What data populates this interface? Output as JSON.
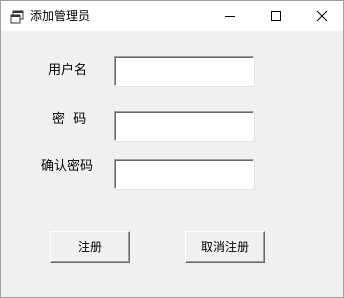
{
  "window": {
    "title": "添加管理员",
    "icon": "app-window-icon",
    "controls": [
      "minimize-icon",
      "maximize-icon",
      "close-icon"
    ]
  },
  "form": {
    "username_label": "用户名",
    "username_value": "",
    "password_label": "密  码",
    "password_value": "",
    "confirm_label": "确认密码",
    "confirm_value": ""
  },
  "buttons": {
    "register_label": "注册",
    "cancel_label": "取消注册"
  }
}
